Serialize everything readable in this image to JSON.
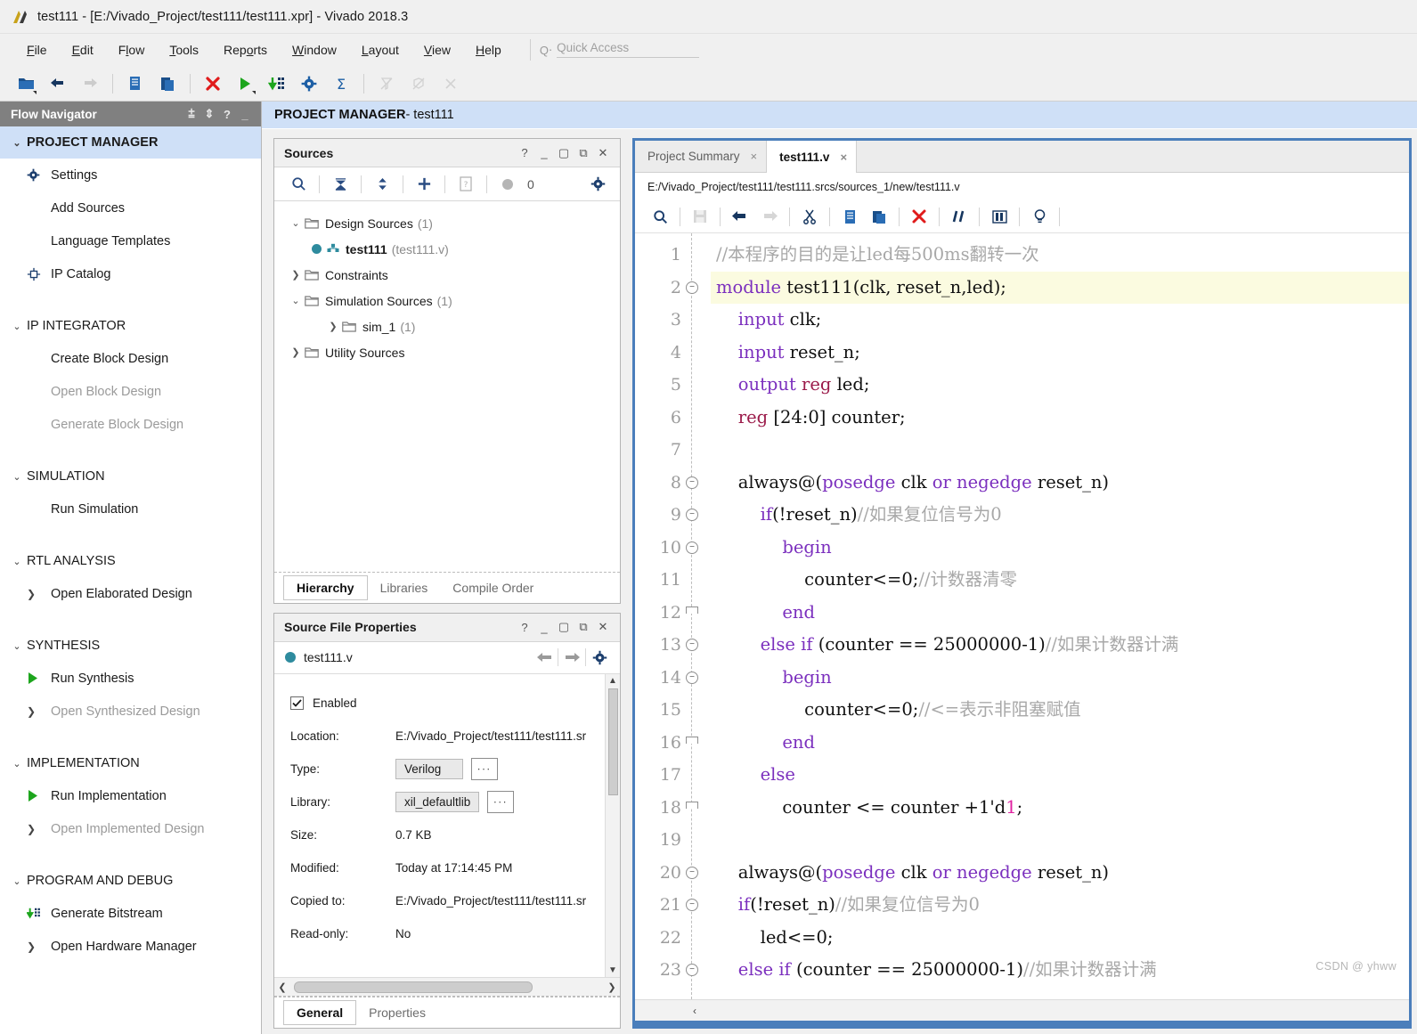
{
  "window": {
    "title": "test111 - [E:/Vivado_Project/test111/test111.xpr] - Vivado 2018.3",
    "logo_icon": "vivado-logo-icon"
  },
  "menubar": {
    "items": [
      {
        "label": "File",
        "mnemonic": "F"
      },
      {
        "label": "Edit",
        "mnemonic": "E"
      },
      {
        "label": "Flow",
        "mnemonic": "l"
      },
      {
        "label": "Tools",
        "mnemonic": "T"
      },
      {
        "label": "Reports",
        "mnemonic": "o"
      },
      {
        "label": "Window",
        "mnemonic": "W"
      },
      {
        "label": "Layout",
        "mnemonic": "L"
      },
      {
        "label": "View",
        "mnemonic": "V"
      },
      {
        "label": "Help",
        "mnemonic": "H"
      }
    ],
    "quick_access": {
      "icon": "search-icon",
      "placeholder": "Quick Access",
      "value": ""
    }
  },
  "toolbar": {
    "buttons": [
      {
        "name": "open-project-icon",
        "title": "Open Project",
        "enabled": true,
        "dropdown": true
      },
      {
        "name": "undo-icon",
        "title": "Undo",
        "enabled": true
      },
      {
        "name": "redo-icon",
        "title": "Redo",
        "enabled": false
      },
      {
        "name": "copy-icon",
        "title": "Copy",
        "enabled": true
      },
      {
        "name": "paste-icon",
        "title": "Paste",
        "enabled": true
      },
      {
        "name": "delete-icon",
        "title": "Delete",
        "enabled": true
      },
      {
        "name": "run-icon",
        "title": "Run",
        "enabled": true,
        "dropdown": true
      },
      {
        "name": "generate-bitstream-icon",
        "title": "Generate Bitstream",
        "enabled": true
      },
      {
        "name": "settings-gear-icon",
        "title": "Settings",
        "enabled": true
      },
      {
        "name": "sigma-icon",
        "title": "Report",
        "enabled": true
      },
      {
        "name": "no-synthesis-icon",
        "title": "Synthesis",
        "enabled": false
      },
      {
        "name": "no-implementation-icon",
        "title": "Implementation",
        "enabled": false
      },
      {
        "name": "no-bitstream-icon",
        "title": "Bitstream",
        "enabled": false
      }
    ]
  },
  "flow_navigator": {
    "title": "Flow Navigator",
    "header_icons": [
      "collapse-all-icon",
      "expand-collapse-icon",
      "help-icon",
      "minimize-icon"
    ],
    "sections": [
      {
        "label": "PROJECT MANAGER",
        "active": true,
        "items": [
          {
            "label": "Settings",
            "icon": "gear-icon",
            "disabled": false
          },
          {
            "label": "Add Sources",
            "icon": "none",
            "disabled": false
          },
          {
            "label": "Language Templates",
            "icon": "none",
            "disabled": false
          },
          {
            "label": "IP Catalog",
            "icon": "ip-catalog-icon",
            "disabled": false
          }
        ]
      },
      {
        "label": "IP INTEGRATOR",
        "active": false,
        "items": [
          {
            "label": "Create Block Design",
            "icon": "none",
            "disabled": false
          },
          {
            "label": "Open Block Design",
            "icon": "none",
            "disabled": true
          },
          {
            "label": "Generate Block Design",
            "icon": "none",
            "disabled": true
          }
        ]
      },
      {
        "label": "SIMULATION",
        "active": false,
        "items": [
          {
            "label": "Run Simulation",
            "icon": "none",
            "disabled": false
          }
        ]
      },
      {
        "label": "RTL ANALYSIS",
        "active": false,
        "items": [
          {
            "label": "Open Elaborated Design",
            "icon": "chevron-right-icon",
            "disabled": false
          }
        ]
      },
      {
        "label": "SYNTHESIS",
        "active": false,
        "items": [
          {
            "label": "Run Synthesis",
            "icon": "green-play-icon",
            "disabled": false
          },
          {
            "label": "Open Synthesized Design",
            "icon": "chevron-right-icon",
            "disabled": true
          }
        ]
      },
      {
        "label": "IMPLEMENTATION",
        "active": false,
        "items": [
          {
            "label": "Run Implementation",
            "icon": "green-play-icon",
            "disabled": false
          },
          {
            "label": "Open Implemented Design",
            "icon": "chevron-right-icon",
            "disabled": true
          }
        ]
      },
      {
        "label": "PROGRAM AND DEBUG",
        "active": false,
        "items": [
          {
            "label": "Generate Bitstream",
            "icon": "generate-bitstream-icon",
            "disabled": false
          },
          {
            "label": "Open Hardware Manager",
            "icon": "chevron-right-icon",
            "disabled": false
          }
        ]
      }
    ]
  },
  "project_bar": {
    "title": "PROJECT MANAGER",
    "subtitle": " - test111"
  },
  "sources_panel": {
    "title": "Sources",
    "window_icons": [
      "help-icon",
      "minimize-icon",
      "maximize-icon",
      "float-icon",
      "close-icon"
    ],
    "toolbar": {
      "search": "search-icon",
      "collapse": "collapse-all-icon",
      "expand": "expand-all-icon",
      "add": "plus-icon",
      "report": "report-icon",
      "message_count": "0",
      "settings": "gear-icon"
    },
    "tree": [
      {
        "label": "Design Sources",
        "count": "(1)",
        "level": 0,
        "twisty": "open",
        "icon": "folder-icon",
        "bold": false
      },
      {
        "label": "test111",
        "count": "(test111.v)",
        "level": 1,
        "twisty": "none",
        "icon": "verilog-module-icon",
        "bold": true
      },
      {
        "label": "Constraints",
        "count": "",
        "level": 0,
        "twisty": "closed",
        "icon": "folder-icon",
        "bold": false
      },
      {
        "label": "Simulation Sources",
        "count": "(1)",
        "level": 0,
        "twisty": "open",
        "icon": "folder-icon",
        "bold": false
      },
      {
        "label": "sim_1",
        "count": "(1)",
        "level": 1,
        "twisty": "closed",
        "icon": "folder-icon",
        "bold": false
      },
      {
        "label": "Utility Sources",
        "count": "",
        "level": 0,
        "twisty": "closed",
        "icon": "folder-icon",
        "bold": false
      }
    ],
    "tabs": [
      {
        "label": "Hierarchy",
        "selected": true
      },
      {
        "label": "Libraries",
        "selected": false
      },
      {
        "label": "Compile Order",
        "selected": false
      }
    ]
  },
  "properties_panel": {
    "title": "Source File Properties",
    "window_icons": [
      "help-icon",
      "minimize-icon",
      "maximize-icon",
      "float-icon",
      "close-icon"
    ],
    "file_name": "test111.v",
    "nav_icons": [
      "back-arrow-icon",
      "forward-arrow-icon",
      "gear-icon"
    ],
    "enabled_label": "Enabled",
    "enabled_checked": true,
    "fields": [
      {
        "label": "Location:",
        "value": "E:/Vivado_Project/test111/test111.sr",
        "type": "text"
      },
      {
        "label": "Type:",
        "value": "Verilog",
        "type": "combo"
      },
      {
        "label": "Library:",
        "value": "xil_defaultlib",
        "type": "combo"
      },
      {
        "label": "Size:",
        "value": "0.7 KB",
        "type": "text"
      },
      {
        "label": "Modified:",
        "value": "Today at 17:14:45 PM",
        "type": "text"
      },
      {
        "label": "Copied to:",
        "value": "E:/Vivado_Project/test111/test111.sr",
        "type": "text"
      },
      {
        "label": "Read-only:",
        "value": "No",
        "type": "text"
      }
    ],
    "ellipsis_label": "∙∙∙",
    "tabs": [
      {
        "label": "General",
        "selected": true
      },
      {
        "label": "Properties",
        "selected": false
      }
    ]
  },
  "editor": {
    "tabs": [
      {
        "label": "Project Summary",
        "selected": false,
        "close": "×"
      },
      {
        "label": "test111.v",
        "selected": true,
        "close": "×"
      }
    ],
    "file_path": "E:/Vivado_Project/test111/test111.srcs/sources_1/new/test111.v",
    "toolbar": [
      {
        "name": "search-icon",
        "enabled": true
      },
      {
        "name": "save-icon",
        "enabled": false
      },
      {
        "name": "undo-icon",
        "enabled": true
      },
      {
        "name": "redo-icon",
        "enabled": false
      },
      {
        "name": "cut-icon",
        "enabled": true
      },
      {
        "name": "copy-icon",
        "enabled": true
      },
      {
        "name": "paste-icon",
        "enabled": true
      },
      {
        "name": "delete-icon",
        "enabled": true
      },
      {
        "name": "comment-icon",
        "enabled": true
      },
      {
        "name": "columns-icon",
        "enabled": true
      },
      {
        "name": "bulb-icon",
        "enabled": true
      }
    ],
    "highlight_line": 2,
    "fold_lines": [
      2,
      8,
      9,
      10,
      12,
      13,
      14,
      16,
      18,
      20,
      21,
      23
    ],
    "lines": [
      {
        "n": 1,
        "fold": "",
        "tokens": [
          {
            "t": "//本程序的目的是让led每500ms翻转一次",
            "c": "cm"
          }
        ]
      },
      {
        "n": 2,
        "fold": "open",
        "tokens": [
          {
            "t": "module",
            "c": "k"
          },
          {
            "t": " test111(clk, reset_n,led);",
            "c": "pl"
          }
        ]
      },
      {
        "n": 3,
        "fold": "",
        "tokens": [
          {
            "t": "    ",
            "c": "pl"
          },
          {
            "t": "input",
            "c": "k"
          },
          {
            "t": " clk;",
            "c": "pl"
          }
        ]
      },
      {
        "n": 4,
        "fold": "",
        "tokens": [
          {
            "t": "    ",
            "c": "pl"
          },
          {
            "t": "input",
            "c": "k"
          },
          {
            "t": " reset_n;",
            "c": "pl"
          }
        ]
      },
      {
        "n": 5,
        "fold": "",
        "tokens": [
          {
            "t": "    ",
            "c": "pl"
          },
          {
            "t": "output",
            "c": "k"
          },
          {
            "t": " ",
            "c": "pl"
          },
          {
            "t": "reg",
            "c": "kr"
          },
          {
            "t": " led;",
            "c": "pl"
          }
        ]
      },
      {
        "n": 6,
        "fold": "",
        "tokens": [
          {
            "t": "    ",
            "c": "pl"
          },
          {
            "t": "reg",
            "c": "kr"
          },
          {
            "t": " [24:0] counter;",
            "c": "pl"
          }
        ]
      },
      {
        "n": 7,
        "fold": "",
        "tokens": [
          {
            "t": "",
            "c": "pl"
          }
        ]
      },
      {
        "n": 8,
        "fold": "open",
        "tokens": [
          {
            "t": "    always@(",
            "c": "pl"
          },
          {
            "t": "posedge",
            "c": "k"
          },
          {
            "t": " clk ",
            "c": "pl"
          },
          {
            "t": "or",
            "c": "k"
          },
          {
            "t": " ",
            "c": "pl"
          },
          {
            "t": "negedge",
            "c": "k"
          },
          {
            "t": " reset_n)",
            "c": "pl"
          }
        ]
      },
      {
        "n": 9,
        "fold": "open",
        "tokens": [
          {
            "t": "        ",
            "c": "pl"
          },
          {
            "t": "if",
            "c": "k"
          },
          {
            "t": "(!reset_n)",
            "c": "pl"
          },
          {
            "t": "//如果复位信号为0",
            "c": "cm"
          }
        ]
      },
      {
        "n": 10,
        "fold": "open",
        "tokens": [
          {
            "t": "            ",
            "c": "pl"
          },
          {
            "t": "begin",
            "c": "k"
          }
        ]
      },
      {
        "n": 11,
        "fold": "",
        "tokens": [
          {
            "t": "                counter<=0;",
            "c": "pl"
          },
          {
            "t": "//计数器清零",
            "c": "cm"
          }
        ]
      },
      {
        "n": 12,
        "fold": "close",
        "tokens": [
          {
            "t": "            ",
            "c": "pl"
          },
          {
            "t": "end",
            "c": "k"
          }
        ]
      },
      {
        "n": 13,
        "fold": "open",
        "tokens": [
          {
            "t": "        ",
            "c": "pl"
          },
          {
            "t": "else if",
            "c": "k"
          },
          {
            "t": " (counter == 25000000-1)",
            "c": "pl"
          },
          {
            "t": "//如果计数器计满",
            "c": "cm"
          }
        ]
      },
      {
        "n": 14,
        "fold": "open",
        "tokens": [
          {
            "t": "            ",
            "c": "pl"
          },
          {
            "t": "begin",
            "c": "k"
          }
        ]
      },
      {
        "n": 15,
        "fold": "",
        "tokens": [
          {
            "t": "                counter<=0;",
            "c": "pl"
          },
          {
            "t": "//<=表示非阻塞赋值",
            "c": "cm"
          }
        ]
      },
      {
        "n": 16,
        "fold": "close",
        "tokens": [
          {
            "t": "            ",
            "c": "pl"
          },
          {
            "t": "end",
            "c": "k"
          }
        ]
      },
      {
        "n": 17,
        "fold": "",
        "tokens": [
          {
            "t": "        ",
            "c": "pl"
          },
          {
            "t": "else",
            "c": "k"
          }
        ]
      },
      {
        "n": 18,
        "fold": "close",
        "tokens": [
          {
            "t": "            counter <= counter +1",
            "c": "pl"
          },
          {
            "t": "'d",
            "c": "pl"
          },
          {
            "t": "1",
            "c": "num"
          },
          {
            "t": ";",
            "c": "pl"
          }
        ]
      },
      {
        "n": 19,
        "fold": "",
        "tokens": [
          {
            "t": "",
            "c": "pl"
          }
        ]
      },
      {
        "n": 20,
        "fold": "open",
        "tokens": [
          {
            "t": "    always@(",
            "c": "pl"
          },
          {
            "t": "posedge",
            "c": "k"
          },
          {
            "t": " clk ",
            "c": "pl"
          },
          {
            "t": "or",
            "c": "k"
          },
          {
            "t": " ",
            "c": "pl"
          },
          {
            "t": "negedge",
            "c": "k"
          },
          {
            "t": " reset_n)",
            "c": "pl"
          }
        ]
      },
      {
        "n": 21,
        "fold": "open",
        "tokens": [
          {
            "t": "    ",
            "c": "pl"
          },
          {
            "t": "if",
            "c": "k"
          },
          {
            "t": "(!reset_n)",
            "c": "pl"
          },
          {
            "t": "//如果复位信号为0",
            "c": "cm"
          }
        ]
      },
      {
        "n": 22,
        "fold": "",
        "tokens": [
          {
            "t": "        led<=0;",
            "c": "pl"
          }
        ]
      },
      {
        "n": 23,
        "fold": "open",
        "tokens": [
          {
            "t": "    ",
            "c": "pl"
          },
          {
            "t": "else if",
            "c": "k"
          },
          {
            "t": " (counter == 25000000-1)",
            "c": "pl"
          },
          {
            "t": "//如果计数器计满",
            "c": "cm"
          }
        ]
      }
    ],
    "scroll_left_arrow": "‹"
  },
  "watermark": "CSDN @ yhww"
}
